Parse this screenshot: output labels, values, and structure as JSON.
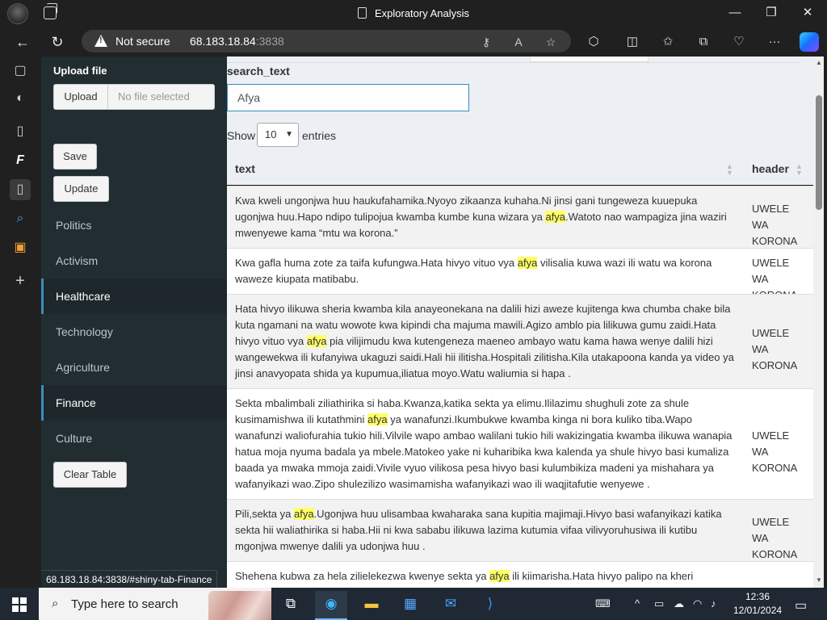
{
  "browser": {
    "window_title": "Exploratory Analysis",
    "security_label": "Not secure",
    "url_host": "68.183.18.84",
    "url_port": ":3838",
    "status_url": "68.183.18.84:3838/#shiny-tab-Finance"
  },
  "sidebar": {
    "upload_label": "Upload file",
    "upload_button": "Upload",
    "upload_placeholder": "No file selected",
    "save_button": "Save",
    "update_button": "Update",
    "menu": [
      "Politics",
      "Activism",
      "Healthcare",
      "Technology",
      "Agriculture",
      "Finance",
      "Culture"
    ],
    "active_items": [
      "Healthcare",
      "Finance"
    ],
    "clear_table_button": "Clear Table"
  },
  "main": {
    "search_label": "search_text",
    "search_value": "Afya",
    "show_label": "Show",
    "entries_value": "10",
    "entries_label": "entries",
    "columns": [
      "text",
      "header"
    ],
    "rows": [
      {
        "pre": "Kwa kweli ungonjwa huu haukufahamika.Nyoyo zikaanza kuhaha.Ni jinsi gani tungeweza kuuepuka ugonjwa huu.Hapo ndipo tulipojua kwamba kumbe kuna wizara ya ",
        "match": "afya",
        "post": ".Watoto nao wampagiza jina waziri mwenyewe kama “mtu wa korona.”",
        "header": "UWELE WA KORONA"
      },
      {
        "pre": "Kwa gafla huma zote za taifa kufungwa.Hata hivyo vituo vya ",
        "match": "afya",
        "post": " vilisalia kuwa wazi ili watu wa korona waweze kiupata matibabu.",
        "header": "UWELE WA KORONA"
      },
      {
        "pre": "Hata hivyo ilikuwa sheria kwamba kila anayeonekana na dalili hizi aweze kujitenga kwa chumba chake bila kuta ngamani na watu wowote kwa kipindi cha majuma mawili.Agizo amblo pia lilikuwa gumu zaidi.Hata hivyo vituo vya ",
        "match": "afya",
        "post": " pia vilijimudu kwa kutengeneza maeneo ambayo watu kama hawa wenye dalili hizi wangewekwa ili kufanyiwa ukaguzi saidi.Hali hii ilitisha.Hospitali zilitisha.Kila utakapoona kanda ya video ya jinsi anavyopata shida ya kupumua,iliatua moyo.Watu waliumia si hapa .",
        "header": "UWELE WA KORONA"
      },
      {
        "pre": "Sekta mbalimbali ziliathirika si haba.Kwanza,katika sekta ya elimu.Ililazimu shughuli zote za shule kusimamishwa ili kutathmini ",
        "match": "afya",
        "post": " ya wanafunzi.Ikumbukwe kwamba kinga ni bora kuliko tiba.Wapo wanafunzi waliofurahia tukio hili.Vilvile wapo ambao walilani tukio hili wakizingatia kwamba ilikuwa wanapia hatua moja nyuma badala ya mbele.Matokeo yake ni kuharibika kwa kalenda ya shule hivyo basi kumaliza baada ya mwaka mmoja zaidi.Vivile vyuo vilikosa pesa hivyo basi kulumbikiza madeni ya mishahara ya wafanyikazi wao.Zipo shulezilizo wasimamisha wafanyikazi wao ili waqjitafutie wenyewe .",
        "header": "UWELE WA KORONA"
      },
      {
        "pre": "Pili,sekta ya ",
        "match": "afya",
        "post": ".Ugonjwa huu ulisambaa kwaharaka sana kupitia majimaji.Hivyo basi wafanyikazi katika sekta hii waliathirika si haba.Hii ni kwa sababu ilikuwa lazima kutumia vifaa vilivyoruhusiwa ili kutibu mgonjwa mwenye dalili ya udonjwa huu .",
        "header": "UWELE WA KORONA"
      },
      {
        "pre": "Shehena kubwa za hela zilielekezwa kwenye sekta ya ",
        "match": "afya",
        "post": " ili kiimarisha.Hata hivyo palipo na kheri",
        "header": ""
      }
    ]
  },
  "taskbar": {
    "search_placeholder": "Type here to search",
    "time": "12:36",
    "date": "12/01/2024"
  }
}
